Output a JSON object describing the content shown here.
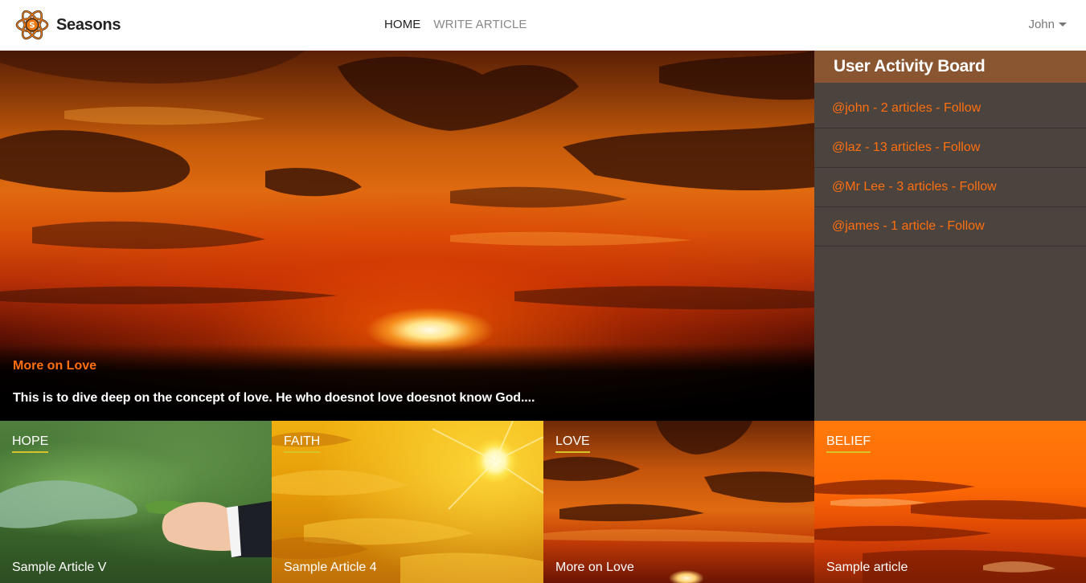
{
  "app": {
    "name": "Seasons"
  },
  "nav": {
    "links": [
      {
        "label": "HOME",
        "active": true
      },
      {
        "label": "WRITE ARTICLE",
        "active": false
      }
    ],
    "user": {
      "name": "John"
    }
  },
  "hero": {
    "title": "More on Love",
    "description": "This is to dive deep on the concept of love. He who doesnot love doesnot know God...."
  },
  "sidebar": {
    "title": "User Activity Board",
    "items": [
      {
        "label": "@john - 2 articles - Follow"
      },
      {
        "label": "@laz - 13 articles - Follow"
      },
      {
        "label": "@Mr Lee - 3 articles - Follow"
      },
      {
        "label": "@james - 1 article - Follow"
      }
    ]
  },
  "categories": [
    {
      "label": "HOPE",
      "article": "Sample Article V"
    },
    {
      "label": "FAITH",
      "article": "Sample Article 4"
    },
    {
      "label": "LOVE",
      "article": "More on Love"
    },
    {
      "label": "BELIEF",
      "article": "Sample article"
    }
  ],
  "colors": {
    "accent": "#ff6f0f",
    "sidebar_bg": "#4b433e",
    "sidebar_header": "#8a5631",
    "category_underline": "#d6c42a"
  },
  "icons": {
    "logo": "atom-logo-icon",
    "user_menu": "caret-down-icon"
  }
}
